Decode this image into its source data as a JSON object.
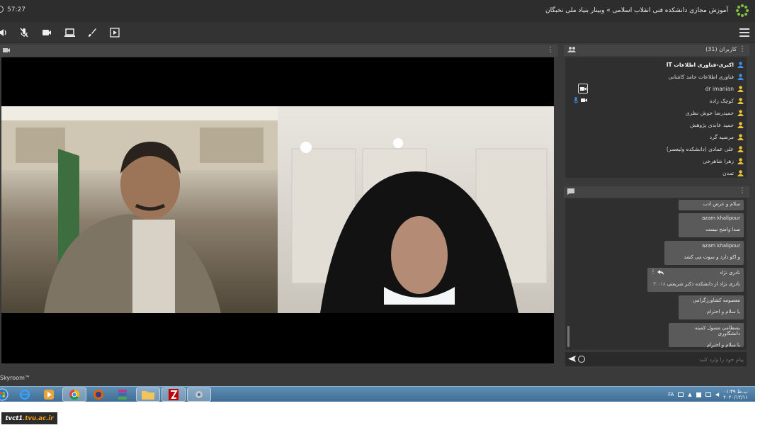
{
  "titlebar": {
    "timer": "57:27",
    "title": "آموزش مجازی دانشکده فنی انقلاب اسلامی » وبینار بنیاد ملی نخبگان"
  },
  "toolbar": {
    "icons": [
      "speaker-icon",
      "mic-muted-icon",
      "camera-icon",
      "screen-share-icon",
      "brush-icon",
      "presentation-icon",
      "menu-icon"
    ]
  },
  "users_panel": {
    "title": "کاربران (31)",
    "users": [
      {
        "name": "اکبری-فناوری اطلاعات IT",
        "role": "admin",
        "bold": true,
        "icon_color": "#3b8fe0"
      },
      {
        "name": "فناوری اطلاعات حامد کاشانی",
        "role": "admin",
        "bold": false,
        "icon_color": "#3b8fe0"
      },
      {
        "name": "dr imanian",
        "role": "presenter",
        "bold": false,
        "icon_color": "#e8c233",
        "camera": true
      },
      {
        "name": "کوچک زاده",
        "role": "presenter",
        "bold": false,
        "icon_color": "#e8c233",
        "camera": true,
        "mic": true
      },
      {
        "name": "حمیدرضا خوش نظری",
        "role": "user",
        "bold": false,
        "icon_color": "#e8c233"
      },
      {
        "name": "حمید عابدی پژوهش",
        "role": "user",
        "bold": false,
        "icon_color": "#e8c233"
      },
      {
        "name": "مرضیه گرد",
        "role": "user",
        "bold": false,
        "icon_color": "#e8c233"
      },
      {
        "name": "علی عمادی (دانشکده ولیعصر)",
        "role": "user",
        "bold": false,
        "icon_color": "#e8c233"
      },
      {
        "name": "زهرا شاهرخی",
        "role": "user",
        "bold": false,
        "icon_color": "#e8c233"
      },
      {
        "name": "تمدن",
        "role": "user",
        "bold": false,
        "icon_color": "#e8c233"
      }
    ]
  },
  "chat": {
    "messages": [
      {
        "author": "",
        "text": "سلام و عرض ادب",
        "time": ""
      },
      {
        "author": "azam khalipour",
        "text": "صدا واضح نیست",
        "time": ""
      },
      {
        "author": "azam khalipour",
        "text": "و اکو دارد و سوت می کشد",
        "time": ""
      },
      {
        "author": "نادری نژاد",
        "text": "نادری نژاد از دانشکده دکتر شریعتی",
        "time": "۳۰:۱۸"
      },
      {
        "author": "معصومه کشاورزگرامی",
        "text": "با سلام و احترام",
        "time": ""
      },
      {
        "author": "بسطامی مسول کمیته دانشگاوری",
        "text": "با سلام و احترام",
        "time": ""
      }
    ],
    "input_placeholder": "پیام خود را وارد کنید"
  },
  "brand": "Skyroom™",
  "taskbar": {
    "apps": [
      "start-orb-icon",
      "ie-icon",
      "media-player-icon",
      "chrome-icon",
      "firefox-icon",
      "winrar-icon",
      "explorer-icon",
      "filezilla-icon",
      "settings-icon"
    ],
    "tray_lang": "FA",
    "clock_time": "۰۱:۴۹ ب.ظ",
    "clock_date": "۲۰۲۰/۱۲/۱۱"
  },
  "footer_logo": {
    "main": "tvct1",
    "accent": ".tvu.ac.ir"
  },
  "colors": {
    "admin_icon": "#3b8fe0",
    "user_icon": "#e8c233",
    "logo_accent": "#f29a1a"
  }
}
